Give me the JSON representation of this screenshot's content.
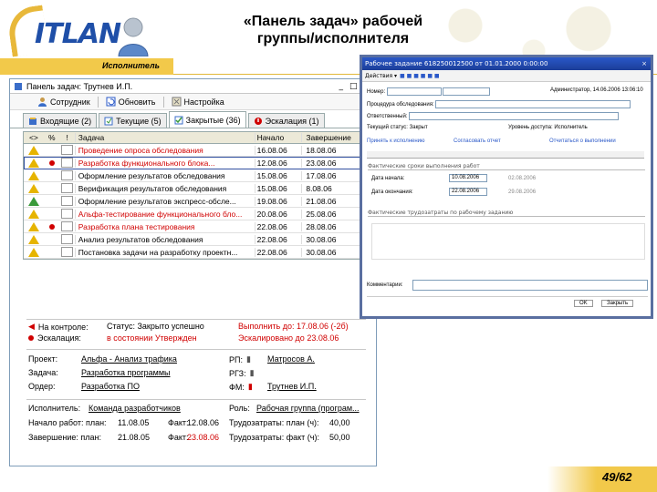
{
  "slide": {
    "title_line1": "«Панель задач» рабочей",
    "title_line2": "группы/исполнителя",
    "role": "Исполнитель",
    "logo": "ITLAN",
    "page": "49/62"
  },
  "window": {
    "title": "Панель задач: Трутнев И.П.",
    "controls": [
      "_",
      "□",
      "×"
    ],
    "toolbar": [
      "Сотрудник",
      "Обновить",
      "Настройка"
    ],
    "tabs": [
      {
        "label": "Входящие (2)",
        "active": false
      },
      {
        "label": "Текущие (5)",
        "active": false
      },
      {
        "label": "Закрытые (36)",
        "active": true
      },
      {
        "label": "Эскалация (1)",
        "active": false
      }
    ],
    "columns": [
      "<>",
      "%",
      "!",
      "Задача",
      "Начало",
      "Завершение"
    ],
    "rows": [
      {
        "task": "Проведение опроса обследования",
        "start": "16.08.06",
        "end": "18.08.06",
        "flag": "yellow",
        "dot": false,
        "red": true
      },
      {
        "task": "Разработка функционального блока...",
        "start": "12.08.06",
        "end": "23.08.06",
        "flag": "yellow",
        "dot": true,
        "red": true
      },
      {
        "task": "Оформление результатов обследования",
        "start": "15.08.06",
        "end": "17.08.06",
        "flag": "yellow",
        "dot": false,
        "red": false
      },
      {
        "task": "Верификация результатов обследования",
        "start": "15.08.06",
        "end": "8.08.06",
        "flag": "yellow",
        "dot": false,
        "red": false
      },
      {
        "task": "Оформление результатов экспресс-обсле...",
        "start": "19.08.06",
        "end": "21.08.06",
        "flag": "green",
        "dot": false,
        "red": false
      },
      {
        "task": "Альфа-тестирование функционального бло...",
        "start": "20.08.06",
        "end": "25.08.06",
        "flag": "yellow",
        "dot": false,
        "red": true
      },
      {
        "task": "Разработка плана тестирования",
        "start": "22.08.06",
        "end": "28.08.06",
        "flag": "yellow",
        "dot": true,
        "red": true
      },
      {
        "task": "Анализ результатов обследования",
        "start": "22.08.06",
        "end": "30.08.06",
        "flag": "yellow",
        "dot": false,
        "red": false
      },
      {
        "task": "Постановка задачи на разработку проектн...",
        "start": "22.08.06",
        "end": "30.08.06",
        "flag": "yellow",
        "dot": false,
        "red": false
      }
    ],
    "status": {
      "control_label": "На контроле:",
      "control_status": "Статус: Закрыто успешно",
      "control_done": "Выполнить до: 17.08.06 (-2б)",
      "esc_label": "Эскалация:",
      "esc_status": "в состоянии Утвержден",
      "esc_done": "Эскалировано до 23.08.06"
    },
    "details": {
      "project_label": "Проект:",
      "project_value": "Альфа - Анализ трафика",
      "task_label": "Задача:",
      "task_value": "Разработка программы",
      "order_label": "Ордер:",
      "order_value": "Разработка ПО",
      "rp_label": "РП:",
      "rp_value": "Матросов А.",
      "rgz_label": "РГЗ:",
      "fm_label": "ФМ:",
      "fm_value": "Трутнев И.П.",
      "executor_label": "Исполнитель:",
      "executor_value": "Команда разработчиков",
      "role_label": "Роль:",
      "role_value": "Рабочая группа (програм...",
      "start_plan_label": "Начало работ: план:",
      "start_plan": "11.08.05",
      "start_fact_label": "Факт:",
      "start_fact": "12.08.06",
      "end_plan_label": "Завершение: план:",
      "end_plan": "21.08.05",
      "end_fact_label": "Факт:",
      "end_fact": "23.08.06",
      "labor_plan_label": "Трудозатраты: план (ч):",
      "labor_plan": "40,00",
      "labor_fact_label": "Трудозатраты: факт (ч):",
      "labor_fact": "50,00"
    }
  },
  "dialog": {
    "title": "Рабочее задание 618250012500  от 01.01.2000 0:00:00",
    "toolbar": "Действия ▾",
    "number_label": "Номер:",
    "author_label": "Администратор, 14.06.2006 13:06:10",
    "task_line": "Процедура обследования:",
    "resp_line": "Ответственный:",
    "state_label": "Текущий статус: Закрыт",
    "level_label": "Уровень доступа: Исполнитель",
    "btn1": "Принять к исполнению",
    "btn2": "Согласовать отчет",
    "btn3": "Отчитаться о выполнении",
    "sect1": "Фактические сроки выполнения работ",
    "date_start_label": "Дата начала:",
    "date_start": "10.08.2006",
    "date_start_2": "02.08.2006",
    "date_end_label": "Дата окончания:",
    "date_end": "22.08.2006",
    "date_end_2": "29.08.2006",
    "sect2": "Фактические трудозатраты по рабочему заданию",
    "comment_label": "Комментарии:",
    "ok": "OK",
    "close": "Закрыть"
  },
  "colors": {
    "title_bar": "#2a58c8",
    "accent": "#f2c94a",
    "red": "#d00000"
  },
  "icons": [
    "inbox-icon",
    "current-icon",
    "closed-icon",
    "escalation-icon",
    "user-icon",
    "refresh-icon",
    "settings-icon",
    "warning-icon"
  ]
}
